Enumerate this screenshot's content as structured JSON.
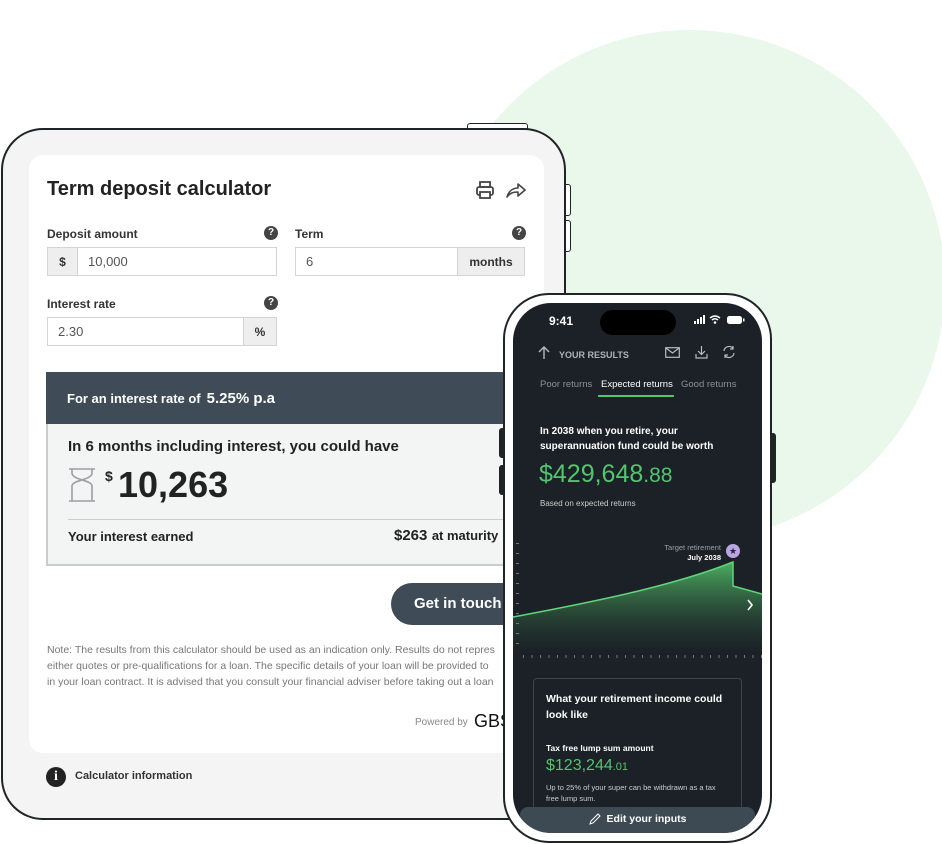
{
  "tablet": {
    "title": "Term deposit calculator",
    "icons": [
      "print-icon",
      "share-icon"
    ],
    "deposit": {
      "label": "Deposit amount",
      "prefix": "$",
      "value": "10,000"
    },
    "term": {
      "label": "Term",
      "value": "6",
      "suffix": "months"
    },
    "rate": {
      "label": "Interest rate",
      "value": "2.30",
      "suffix": "%"
    },
    "help_glyph": "?",
    "result": {
      "header_prefix": "For an interest rate of",
      "header_rate": "5.25% p.a",
      "headline": "In 6 months including interest, you could have",
      "currency": "$",
      "amount": "10,263",
      "interest_label": "Your interest earned",
      "interest_value": "$263",
      "interest_suffix": "at maturity"
    },
    "cta": "Get in touch",
    "note_lines": [
      "Note: The results from this calculator should be used as an indication only. Results do not repres",
      "either quotes or pre-qualifications for a loan. The specific details of your loan will be provided to",
      "in your loan contract. It is advised that you consult your financial adviser before taking out a loan"
    ],
    "powered_by": "Powered by",
    "logo": "GBS",
    "info_label": "Calculator information"
  },
  "phone": {
    "time": "9:41",
    "header_title": "YOUR RESULTS",
    "tabs": [
      {
        "label": "Poor returns",
        "active": false
      },
      {
        "label": "Expected returns",
        "active": true
      },
      {
        "label": "Good returns",
        "active": false
      }
    ],
    "intro_line1": "In 2038 when you retire, your",
    "intro_line2": "superannuation fund could be worth",
    "fund_main": "$429,648",
    "fund_cents": ".88",
    "basis": "Based on expected returns",
    "target_label": "Target retirement",
    "target_date": "July 2038",
    "card": {
      "title_line1": "What your retirement income could",
      "title_line2": "look like",
      "lump_label": "Tax free lump sum amount",
      "lump_main": "$123,244",
      "lump_cents": ".01",
      "desc_line1": "Up to 25% of your super can be withdrawn as a tax",
      "desc_line2": "free lump sum."
    },
    "edit": "Edit your inputs"
  },
  "colors": {
    "accent_green": "#53c56e",
    "dark_slate": "#3f4c57",
    "phone_bg": "#1b2126",
    "bg_circle": "#e9f8ea"
  }
}
